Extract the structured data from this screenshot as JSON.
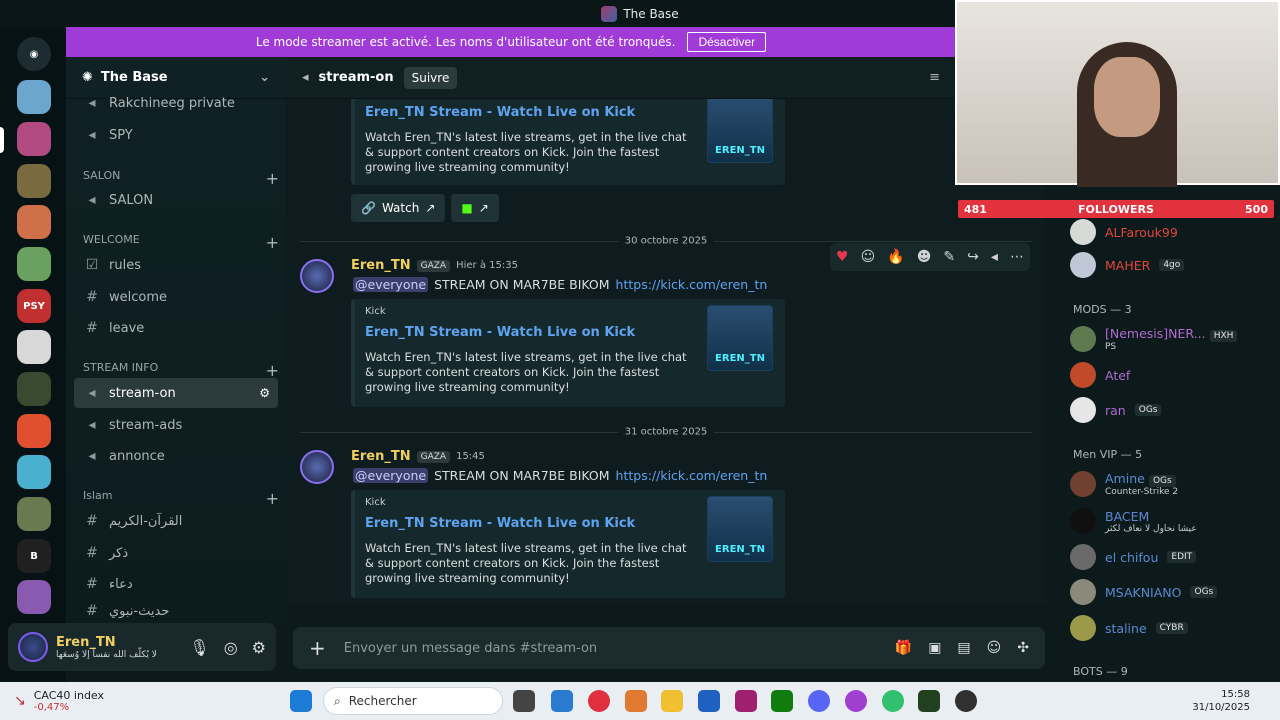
{
  "window": {
    "title": "The Base"
  },
  "banner": {
    "text": "Le mode streamer est activé. Les noms d'utilisateur ont été tronqués.",
    "button": "Désactiver"
  },
  "server": {
    "name": "The Base"
  },
  "sidebar": {
    "top_items": [
      {
        "label": "Rakchineeg private"
      },
      {
        "label": "SPY"
      }
    ],
    "categories": [
      {
        "label": "SALON",
        "channels": [
          "SALON"
        ]
      },
      {
        "label": "WELCOME",
        "channels": [
          "rules",
          "welcome",
          "leave"
        ]
      },
      {
        "label": "STREAM INFO",
        "channels": [
          "stream-on",
          "stream-ads",
          "annonce"
        ]
      },
      {
        "label": "Islam",
        "channels": [
          "القرآن-الكريم",
          "ذكر",
          "دعاء",
          "حديث-نبوي"
        ]
      }
    ]
  },
  "user": {
    "name": "Eren_TN",
    "status": "لا يُكلّف الله نفساً إلا وُسعَها"
  },
  "channel": {
    "name": "stream-on",
    "follow": "Suivre"
  },
  "messages": {
    "top_embed": {
      "title": "Eren_TN Stream - Watch Live on Kick",
      "desc": "Watch Eren_TN's latest live streams, get in the live chat & support content creators on Kick. Join the fastest growing live streaming community!",
      "thumb": "EREN_TN",
      "watch": "Watch"
    },
    "d1": "30 octobre 2025",
    "m1": {
      "user": "Eren_TN",
      "tag": "GAZA",
      "ts": "Hier à 15:35",
      "mention": "@everyone",
      "text": "STREAM ON MAR7BE BIKOM",
      "link": "https://kick.com/eren_tn",
      "provider": "Kick",
      "etitle": "Eren_TN Stream - Watch Live on Kick",
      "edesc": "Watch Eren_TN's latest live streams, get in the live chat & support content creators on Kick. Join the fastest growing live streaming community!",
      "thumb": "EREN_TN"
    },
    "d2": "31 octobre 2025",
    "m2": {
      "user": "Eren_TN",
      "tag": "GAZA",
      "ts": "15:45",
      "mention": "@everyone",
      "text": "STREAM ON MAR7BE BIKOM",
      "link": "https://kick.com/eren_tn",
      "provider": "Kick",
      "etitle": "Eren_TN Stream - Watch Live on Kick",
      "edesc": "Watch Eren_TN's latest live streams, get in the live chat & support content creators on Kick. Join the fastest growing live streaming community!",
      "thumb": "EREN_TN"
    }
  },
  "composer": {
    "placeholder": "Envoyer un message dans #stream-on"
  },
  "followers": {
    "current": "481",
    "label": "FOLLOWERS",
    "goal": "500"
  },
  "members": {
    "top": [
      {
        "name": "ALFarouk99"
      },
      {
        "name": "MAHER",
        "badge": "4go"
      }
    ],
    "mods_label": "MODS — 3",
    "mods": [
      {
        "name": "[Nemesis]NER...",
        "badge": "HXH",
        "sub": "PS"
      },
      {
        "name": "Atef"
      },
      {
        "name": "ran",
        "badge": "OGs"
      }
    ],
    "vip_label": "Men VIP — 5",
    "vip": [
      {
        "name": "Amine",
        "badge": "OGs",
        "sub": "Counter-Strike 2"
      },
      {
        "name": "BACEM",
        "sub": "عيشا نحاول لا نعاف لكثر"
      },
      {
        "name": "el chifou",
        "badge": "EDIT"
      },
      {
        "name": "MSAKNIANO",
        "badge": "OGs"
      },
      {
        "name": "staline",
        "badge": "CYBR"
      }
    ],
    "bots_label": "BOTS — 9"
  },
  "taskbar": {
    "index": "CAC40 index",
    "change": "-0,47%",
    "search": "Rechercher",
    "time": "15:58",
    "date": "31/10/2025"
  },
  "colors": {
    "accent": "#a03bd8",
    "link": "#5ea3f0",
    "username": "#f0d060",
    "follow_bar": "#e2323d"
  }
}
